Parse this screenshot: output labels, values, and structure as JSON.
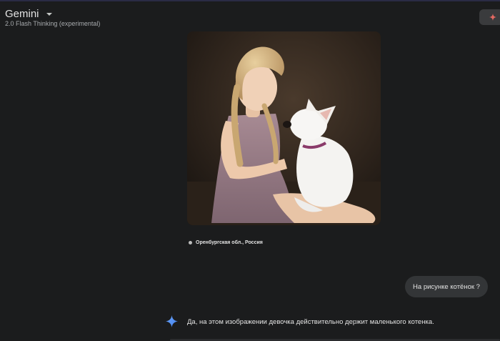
{
  "header": {
    "model_title": "Gemini",
    "model_subtitle": "2.0 Flash Thinking (experimental)",
    "dropdown_icon": "caret-down-icon",
    "corner_icon": "sparkle-icon"
  },
  "message": {
    "image_location": "Оренбургская обл., Россия",
    "user_text": "На рисунке котёнок ?"
  },
  "response": {
    "icon": "gemini-sparkle-icon",
    "text": "Да, на этом изображении девочка действительно держит маленького котенка."
  },
  "colors": {
    "background": "#1b1c1d",
    "bubble": "#333537",
    "accent_blue": "#4c8df6",
    "accent_red": "#e46962"
  }
}
